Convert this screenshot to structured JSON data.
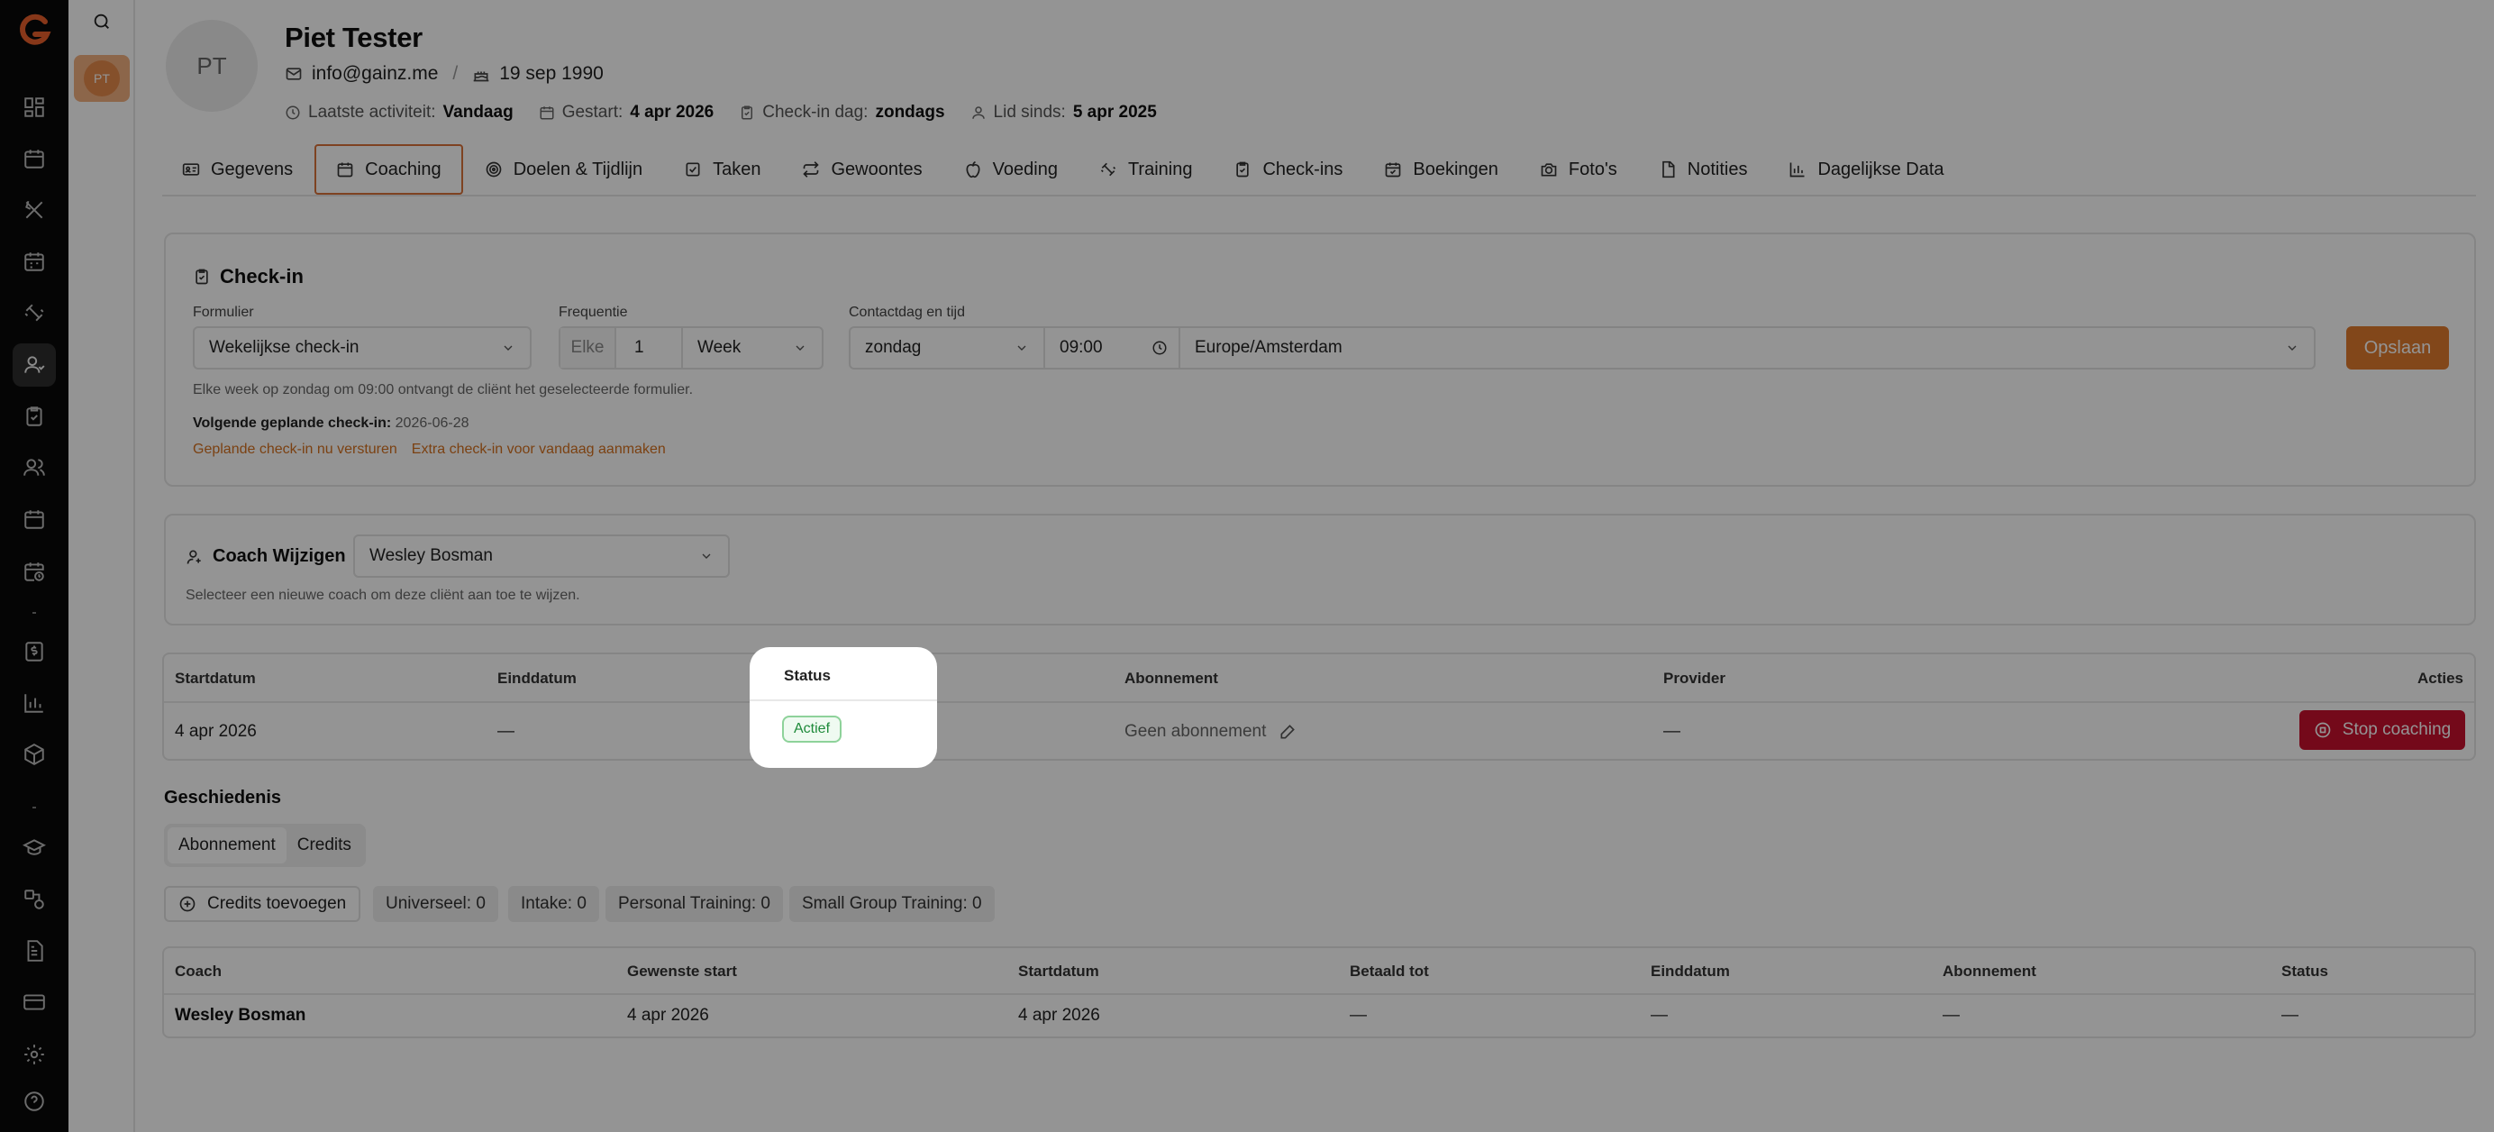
{
  "sidebar": {
    "logo": "G"
  },
  "rail": {
    "user_initials": "PT"
  },
  "client": {
    "initials": "PT",
    "name": "Piet Tester",
    "email": "info@gainz.me",
    "separator": "/",
    "birthdate": "19 sep 1990",
    "last_activity_label": "Laatste activiteit:",
    "last_activity_value": "Vandaag",
    "started_label": "Gestart:",
    "started_value": "4 apr 2026",
    "checkin_day_label": "Check-in dag:",
    "checkin_day_value": "zondags",
    "member_since_label": "Lid sinds:",
    "member_since_value": "5 apr 2025"
  },
  "tabs": [
    {
      "label": "Gegevens",
      "icon": "id-card-icon"
    },
    {
      "label": "Coaching",
      "icon": "calendar-icon"
    },
    {
      "label": "Doelen & Tijdlijn",
      "icon": "target-icon"
    },
    {
      "label": "Taken",
      "icon": "checkbox-icon"
    },
    {
      "label": "Gewoontes",
      "icon": "repeat-icon"
    },
    {
      "label": "Voeding",
      "icon": "apple-icon"
    },
    {
      "label": "Training",
      "icon": "dumbbell-icon"
    },
    {
      "label": "Check-ins",
      "icon": "clipboard-icon"
    },
    {
      "label": "Boekingen",
      "icon": "calendar-check-icon"
    },
    {
      "label": "Foto's",
      "icon": "camera-icon"
    },
    {
      "label": "Notities",
      "icon": "file-icon"
    },
    {
      "label": "Dagelijkse Data",
      "icon": "bar-chart-icon"
    }
  ],
  "checkin": {
    "title": "Check-in",
    "form_label": "Formulier",
    "form_value": "Wekelijkse check-in",
    "freq_label": "Frequentie",
    "freq_prefix": "Elke",
    "freq_number": "1",
    "freq_unit": "Week",
    "contact_label": "Contactdag en tijd",
    "contact_day": "zondag",
    "contact_time": "09:00",
    "timezone": "Europe/Amsterdam",
    "save_label": "Opslaan",
    "help_text": "Elke week op zondag om 09:00 ontvangt de cliënt het geselecteerde formulier.",
    "next_label": "Volgende geplande check-in:",
    "next_value": "2026-06-28",
    "link_send": "Geplande check-in nu versturen",
    "link_extra": "Extra check-in voor vandaag aanmaken"
  },
  "coach": {
    "label": "Coach Wijzigen",
    "value": "Wesley Bosman",
    "help_text": "Selecteer een nieuwe coach om deze cliënt aan toe te wijzen."
  },
  "subscription_table": {
    "headers": [
      "Startdatum",
      "Einddatum",
      "Status",
      "Abonnement",
      "Provider",
      "Acties"
    ],
    "row": {
      "start": "4 apr 2026",
      "end": "—",
      "status": "Actief",
      "subscription": "Geen abonnement",
      "provider": "—",
      "action": "Stop coaching"
    }
  },
  "history": {
    "title": "Geschiedenis",
    "tabs": [
      "Abonnement",
      "Credits"
    ],
    "add_credits": "Credits toevoegen",
    "credits": [
      "Universeel: 0",
      "Intake: 0",
      "Personal Training: 0",
      "Small Group Training: 0"
    ],
    "table_headers": [
      "Coach",
      "Gewenste start",
      "Startdatum",
      "Betaald tot",
      "Einddatum",
      "Abonnement",
      "Status"
    ],
    "table_row": [
      "Wesley Bosman",
      "4 apr 2026",
      "4 apr 2026",
      "—",
      "—",
      "—",
      "—"
    ]
  },
  "colors": {
    "accent": "#e17a2e",
    "danger": "#c8102e",
    "success": "#1e8a3a"
  }
}
